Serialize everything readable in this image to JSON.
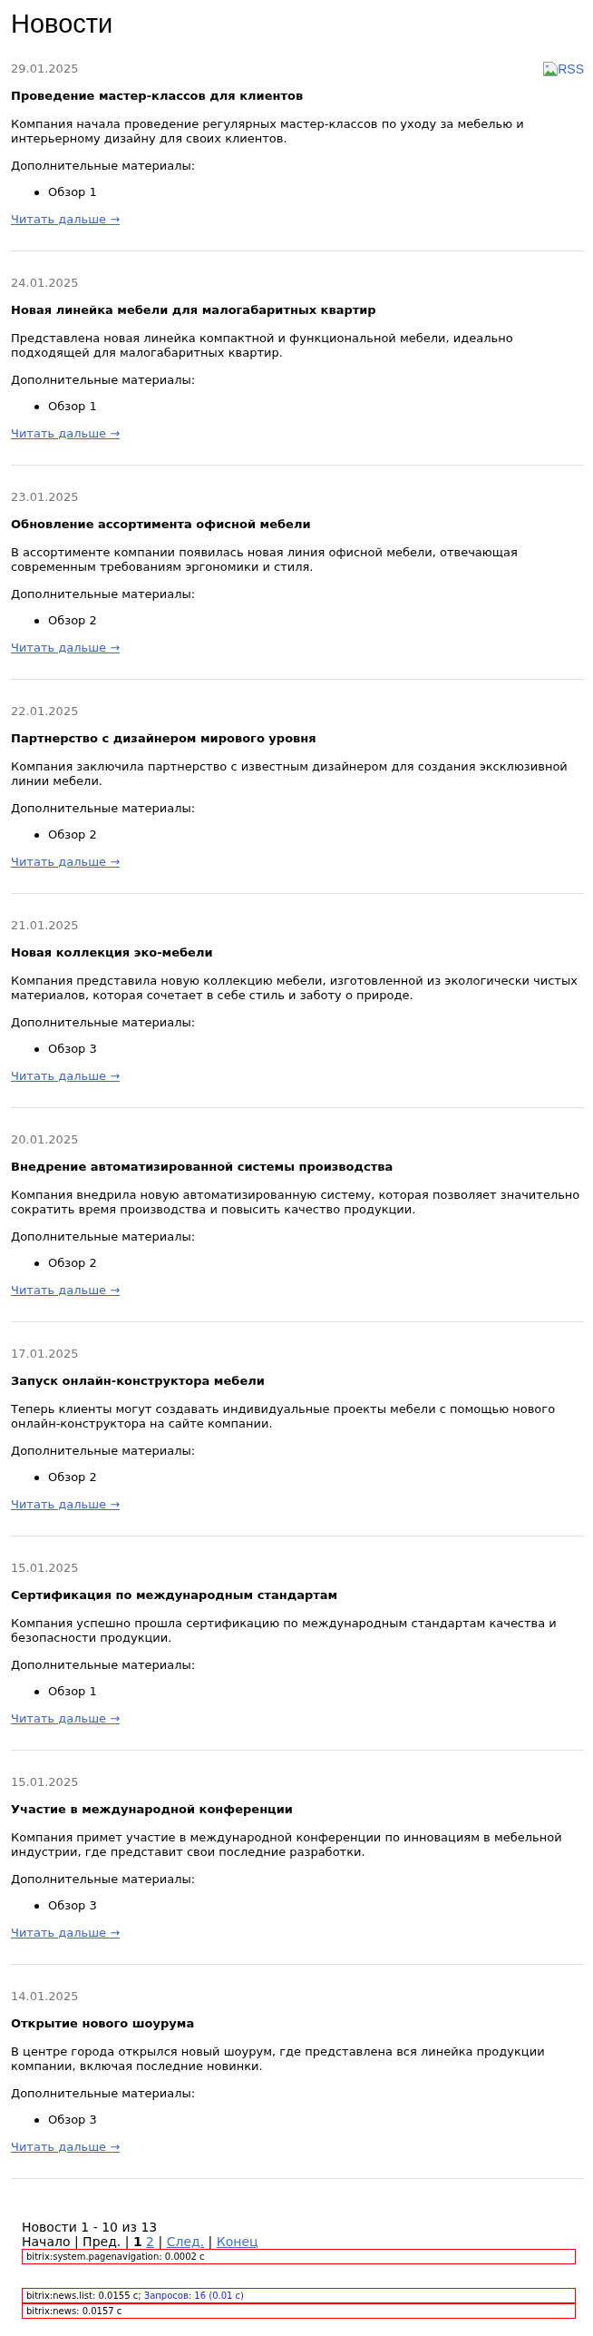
{
  "page": {
    "title": "Новости"
  },
  "rss": {
    "label": "RSS"
  },
  "news": [
    {
      "date": "29.01.2025",
      "title": "Проведение мастер-классов для клиентов",
      "text": "Компания начала проведение регулярных мастер-классов по уходу за мебелью и интерьерному дизайну для своих клиентов.",
      "materials_label": "Дополнительные материалы:",
      "materials": [
        "Обзор 1"
      ],
      "read_more": "Читать дальше →"
    },
    {
      "date": "24.01.2025",
      "title": "Новая линейка мебели для малогабаритных квартир",
      "text": "Представлена новая линейка компактной и функциональной мебели, идеально подходящей для малогабаритных квартир.",
      "materials_label": "Дополнительные материалы:",
      "materials": [
        "Обзор 1"
      ],
      "read_more": "Читать дальше →"
    },
    {
      "date": "23.01.2025",
      "title": "Обновление ассортимента офисной мебели",
      "text": "В ассортименте компании появилась новая линия офисной мебели, отвечающая современным требованиям эргономики и стиля.",
      "materials_label": "Дополнительные материалы:",
      "materials": [
        "Обзор 2"
      ],
      "read_more": "Читать дальше →"
    },
    {
      "date": "22.01.2025",
      "title": "Партнерство с дизайнером мирового уровня",
      "text": "Компания заключила партнерство с известным дизайнером для создания эксклюзивной линии мебели.",
      "materials_label": "Дополнительные материалы:",
      "materials": [
        "Обзор 2"
      ],
      "read_more": "Читать дальше →"
    },
    {
      "date": "21.01.2025",
      "title": "Новая коллекция эко-мебели",
      "text": "Компания представила новую коллекцию мебели, изготовленной из экологически чистых материалов, которая сочетает в себе стиль и заботу о природе.",
      "materials_label": "Дополнительные материалы:",
      "materials": [
        "Обзор 3"
      ],
      "read_more": "Читать дальше →"
    },
    {
      "date": "20.01.2025",
      "title": "Внедрение автоматизированной системы производства",
      "text": "Компания внедрила новую автоматизированную систему, которая позволяет значительно сократить время производства и повысить качество продукции.",
      "materials_label": "Дополнительные материалы:",
      "materials": [
        "Обзор 2"
      ],
      "read_more": "Читать дальше →"
    },
    {
      "date": "17.01.2025",
      "title": "Запуск онлайн-конструктора мебели",
      "text": "Теперь клиенты могут создавать индивидуальные проекты мебели с помощью нового онлайн-конструктора на сайте компании.",
      "materials_label": "Дополнительные материалы:",
      "materials": [
        "Обзор 2"
      ],
      "read_more": "Читать дальше →"
    },
    {
      "date": "15.01.2025",
      "title": "Сертификация по международным стандартам",
      "text": "Компания успешно прошла сертификацию по международным стандартам качества и безопасности продукции.",
      "materials_label": "Дополнительные материалы:",
      "materials": [
        "Обзор 1"
      ],
      "read_more": "Читать дальше →"
    },
    {
      "date": "15.01.2025",
      "title": "Участие в международной конференции",
      "text": "Компания примет участие в международной конференции по инновациям в мебельной индустрии, где представит свои последние разработки.",
      "materials_label": "Дополнительные материалы:",
      "materials": [
        "Обзор 3"
      ],
      "read_more": "Читать дальше →"
    },
    {
      "date": "14.01.2025",
      "title": "Открытие нового шоурума",
      "text": "В центре города открылся новый шоурум, где представлена вся линейка продукции компании, включая последние новинки.",
      "materials_label": "Дополнительные материалы:",
      "materials": [
        "Обзор 3"
      ],
      "read_more": "Читать дальше →"
    }
  ],
  "pagination": {
    "summary": "Новости 1 - 10 из 13",
    "parts": [
      {
        "kind": "nav",
        "label": "Начало",
        "disabled": true
      },
      {
        "kind": "separator",
        "label": "|"
      },
      {
        "kind": "nav",
        "label": "Пред.",
        "disabled": true
      },
      {
        "kind": "separator",
        "label": "|"
      },
      {
        "kind": "page",
        "label": "1",
        "selected": true
      },
      {
        "kind": "page",
        "label": "2",
        "selected": false
      },
      {
        "kind": "separator",
        "label": "|"
      },
      {
        "kind": "nav",
        "label": "След.",
        "disabled": false
      },
      {
        "kind": "separator",
        "label": "|"
      },
      {
        "kind": "nav",
        "label": "Конец",
        "disabled": false
      }
    ],
    "debug": "bitrix:system.pagenavigation: 0.0002 с"
  },
  "debug_panels": [
    {
      "label": "bitrix:news.list: 0.0155 с;",
      "link": "Запросов: 16 (0.01 с)"
    },
    {
      "label": "bitrix:news: 0.0157 с"
    }
  ]
}
